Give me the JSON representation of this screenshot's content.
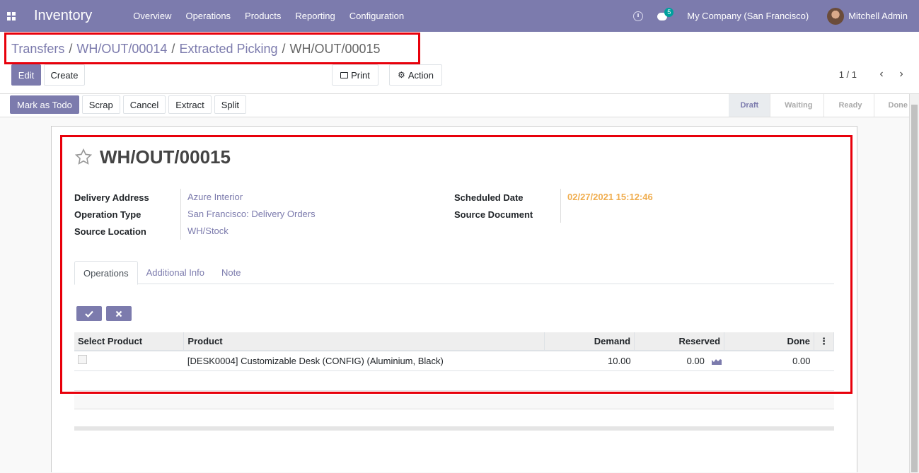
{
  "navbar": {
    "app_title": "Inventory",
    "menu": [
      "Overview",
      "Operations",
      "Products",
      "Reporting",
      "Configuration"
    ],
    "chat_badge": "5",
    "company": "My Company (San Francisco)",
    "user": "Mitchell Admin"
  },
  "breadcrumb": {
    "items": [
      "Transfers",
      "WH/OUT/00014",
      "Extracted Picking"
    ],
    "current": "WH/OUT/00015"
  },
  "toolbar": {
    "edit": "Edit",
    "create": "Create",
    "print": "Print",
    "action": "Action",
    "pager": "1 / 1"
  },
  "statusbar": {
    "buttons": [
      "Mark as Todo",
      "Scrap",
      "Cancel",
      "Extract",
      "Split"
    ],
    "steps": [
      "Draft",
      "Waiting",
      "Ready",
      "Done"
    ],
    "current_step": "Draft"
  },
  "record": {
    "title": "WH/OUT/00015",
    "left_fields": [
      {
        "label": "Delivery Address",
        "value": "Azure Interior"
      },
      {
        "label": "Operation Type",
        "value": "San Francisco: Delivery Orders"
      },
      {
        "label": "Source Location",
        "value": "WH/Stock"
      }
    ],
    "right_fields": [
      {
        "label": "Scheduled Date",
        "value": "02/27/2021 15:12:46"
      },
      {
        "label": "Source Document",
        "value": ""
      }
    ]
  },
  "tabs": [
    "Operations",
    "Additional Info",
    "Note"
  ],
  "table": {
    "headers": [
      "Select Product",
      "Product",
      "Demand",
      "Reserved",
      "Done"
    ],
    "rows": [
      {
        "product": "[DESK0004] Customizable Desk (CONFIG) (Aluminium, Black)",
        "demand": "10.00",
        "reserved": "0.00",
        "done": "0.00"
      }
    ]
  },
  "colors": {
    "brand": "#7c7bad",
    "highlight": "#e8000b",
    "date": "#f0ad4e"
  }
}
